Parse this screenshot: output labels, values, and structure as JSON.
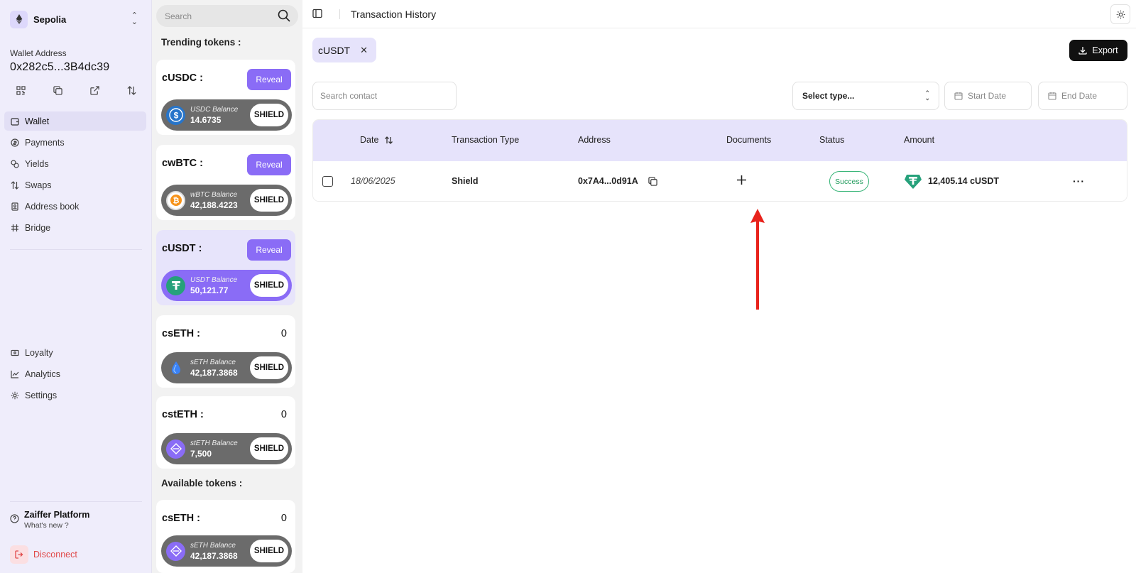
{
  "sidebar": {
    "network": "Sepolia",
    "wallet_label": "Wallet Address",
    "wallet_address": "0x282c5...3B4dc39",
    "nav": [
      {
        "label": "Wallet",
        "icon": "wallet-icon",
        "active": true
      },
      {
        "label": "Payments",
        "icon": "payments-icon"
      },
      {
        "label": "Yields",
        "icon": "yields-icon"
      },
      {
        "label": "Swaps",
        "icon": "swap-icon"
      },
      {
        "label": "Address book",
        "icon": "address-book-icon"
      },
      {
        "label": "Bridge",
        "icon": "bridge-icon"
      }
    ],
    "nav_bottom": [
      {
        "label": "Loyalty",
        "icon": "loyalty-icon"
      },
      {
        "label": "Analytics",
        "icon": "analytics-icon"
      },
      {
        "label": "Settings",
        "icon": "settings-icon"
      }
    ],
    "platform_title": "Zaiffer Platform",
    "platform_sub": "What's new ?",
    "disconnect": "Disconnect"
  },
  "tokens": {
    "search_placeholder": "Search",
    "trending_heading": "Trending tokens :",
    "available_heading": "Available tokens :",
    "reveal_label": "Reveal",
    "shield_label": "SHIELD",
    "trending": [
      {
        "name": "cUSDC :",
        "balance_label": "USDC Balance",
        "balance": "14.6735",
        "coin": "usdc"
      },
      {
        "name": "cwBTC :",
        "balance_label": "wBTC Balance",
        "balance": "42,188.4223",
        "coin": "wbtc"
      },
      {
        "name": "cUSDT :",
        "balance_label": "USDT Balance",
        "balance": "50,121.77",
        "coin": "usdt"
      },
      {
        "name": "csETH :",
        "value": "0",
        "balance_label": "sETH Balance",
        "balance": "42,187.3868",
        "coin": "seth"
      },
      {
        "name": "cstETH :",
        "value": "0",
        "balance_label": "stETH Balance",
        "balance": "7,500",
        "coin": "steth"
      }
    ],
    "available": [
      {
        "name": "csETH :",
        "value": "0",
        "balance_label": "sETH Balance",
        "balance": "42,187.3868",
        "coin": "eth"
      }
    ]
  },
  "main": {
    "title": "Transaction History",
    "filter_chip": "cUSDT",
    "export_label": "Export",
    "search_contact_placeholder": "Search contact",
    "select_type": "Select type...",
    "start_date": "Start Date",
    "end_date": "End Date",
    "columns": [
      "Date",
      "Transaction Type",
      "Address",
      "Documents",
      "Status",
      "Amount"
    ],
    "rows": [
      {
        "date": "18/06/2025",
        "type": "Shield",
        "address": "0x7A4...0d91A",
        "status": "Success",
        "amount": "12,405.14 cUSDT"
      }
    ]
  },
  "colors": {
    "accent": "#8a6cf6",
    "sidebar_bg": "#efedfb",
    "header_bg": "#e6e3fb",
    "success": "#3bb67a",
    "danger": "#e04848",
    "annotation_arrow": "#e8231c"
  }
}
